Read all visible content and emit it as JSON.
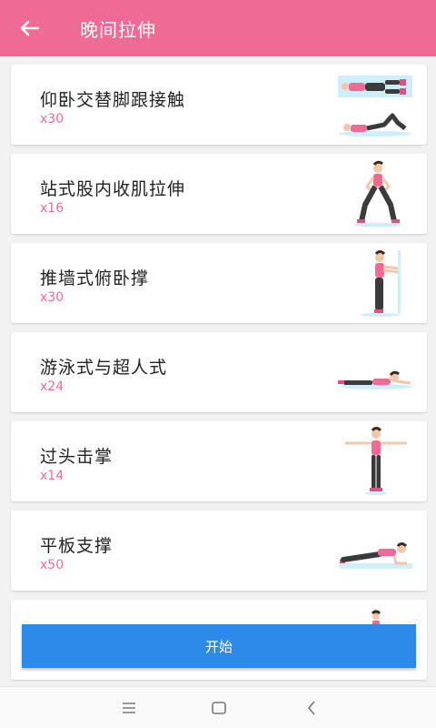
{
  "header": {
    "title": "晚间拉伸",
    "bg_color": "#ef6b96",
    "back_icon": "arrow-left-icon"
  },
  "exercises": [
    {
      "name": "仰卧交替脚跟接触",
      "count": "x30",
      "image": "supine-heel-touch-figure"
    },
    {
      "name": "站式股内收肌拉伸",
      "count": "x16",
      "image": "standing-adductor-stretch-figure"
    },
    {
      "name": "推墙式俯卧撑",
      "count": "x30",
      "image": "wall-push-up-figure"
    },
    {
      "name": "游泳式与超人式",
      "count": "x24",
      "image": "swimming-superman-figure"
    },
    {
      "name": "过头击掌",
      "count": "x14",
      "image": "overhead-clap-figure"
    },
    {
      "name": "平板支撑",
      "count": "x50",
      "image": "plank-figure"
    }
  ],
  "footer": {
    "start_label": "开始",
    "start_color": "#2d8ae8"
  },
  "system_nav": {
    "icons": [
      "menu-icon",
      "home-square-icon",
      "back-chevron-icon"
    ]
  }
}
